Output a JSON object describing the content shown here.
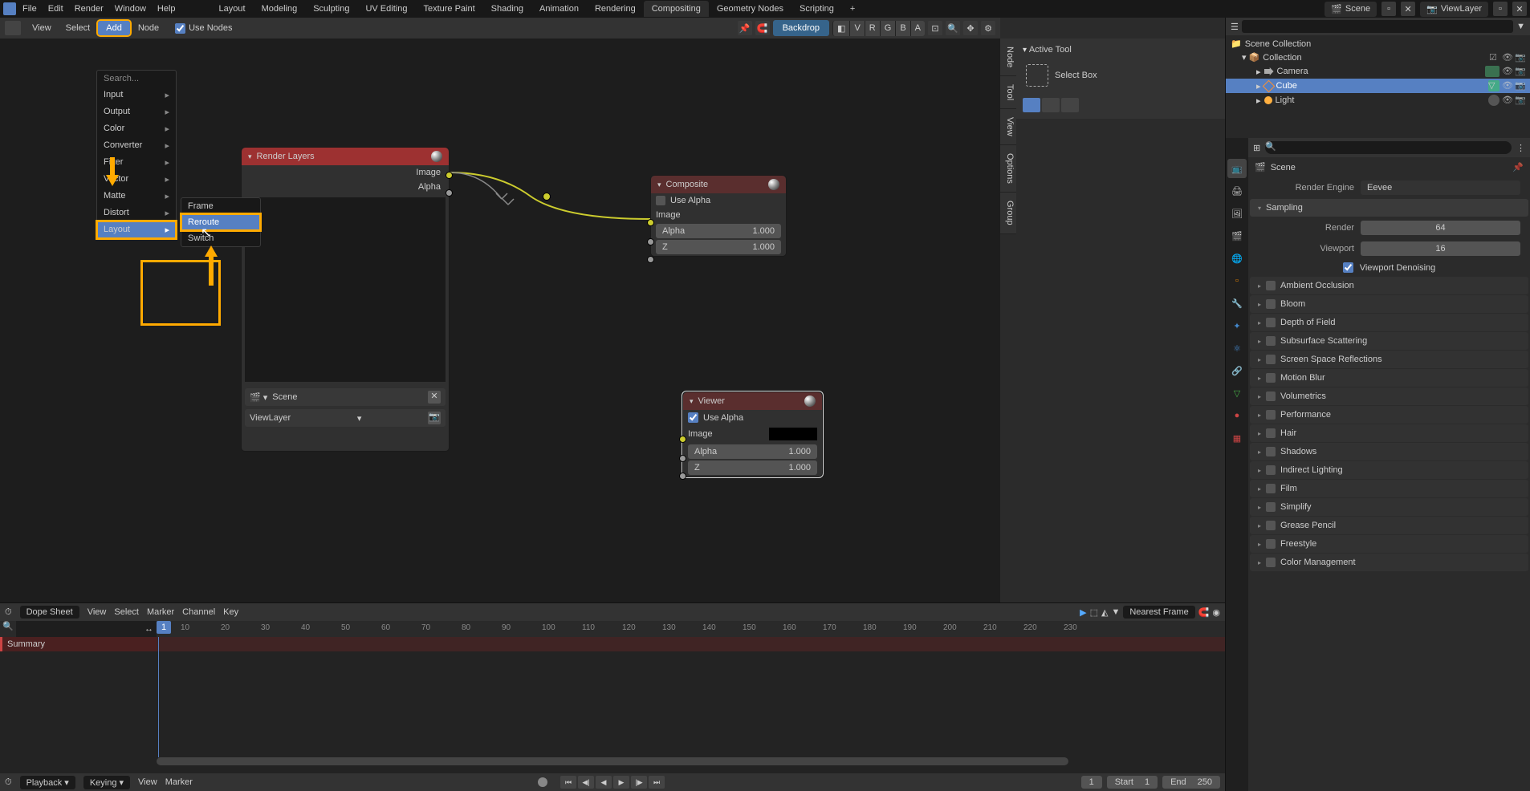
{
  "topbar": {
    "menus": [
      "File",
      "Edit",
      "Render",
      "Window",
      "Help"
    ],
    "tabs": [
      "Layout",
      "Modeling",
      "Sculpting",
      "UV Editing",
      "Texture Paint",
      "Shading",
      "Animation",
      "Rendering",
      "Compositing",
      "Geometry Nodes",
      "Scripting"
    ],
    "active_tab": "Compositing",
    "scene": "Scene",
    "viewlayer": "ViewLayer"
  },
  "compositor_header": {
    "menus": [
      "View",
      "Select"
    ],
    "add": "Add",
    "node": "Node",
    "use_nodes": "Use Nodes",
    "backdrop": "Backdrop",
    "channels": [
      "V",
      "R",
      "G",
      "B",
      "A"
    ]
  },
  "breadcrumb": {
    "scene": "Scene"
  },
  "add_menu": {
    "search": "Search...",
    "items": [
      "Input",
      "Output",
      "Color",
      "Converter",
      "Filter",
      "Vector",
      "Matte",
      "Distort"
    ],
    "highlighted": "Layout"
  },
  "layout_submenu": {
    "items": [
      "Frame",
      "Reroute",
      "Switch"
    ],
    "highlighted": "Reroute"
  },
  "side_tabs": [
    "Node",
    "Tool",
    "View",
    "Options",
    "Group"
  ],
  "n_panel": {
    "title": "Active Tool",
    "tool": "Select Box"
  },
  "nodes": {
    "render_layers": {
      "title": "Render Layers",
      "outputs": [
        "Image",
        "Alpha"
      ],
      "scene": "Scene",
      "viewlayer": "ViewLayer"
    },
    "composite": {
      "title": "Composite",
      "use_alpha": "Use Alpha",
      "image": "Image",
      "alpha_lbl": "Alpha",
      "alpha_val": "1.000",
      "z_lbl": "Z",
      "z_val": "1.000"
    },
    "viewer": {
      "title": "Viewer",
      "use_alpha": "Use Alpha",
      "image": "Image",
      "alpha_lbl": "Alpha",
      "alpha_val": "1.000",
      "z_lbl": "Z",
      "z_val": "1.000"
    }
  },
  "outliner": {
    "root": "Scene Collection",
    "collection": "Collection",
    "items": [
      "Camera",
      "Cube",
      "Light"
    ],
    "selected": "Cube"
  },
  "properties": {
    "scene": "Scene",
    "render_engine_lbl": "Render Engine",
    "render_engine": "Eevee",
    "sampling": "Sampling",
    "render_lbl": "Render",
    "render_val": "64",
    "viewport_lbl": "Viewport",
    "viewport_val": "16",
    "viewport_denoise": "Viewport Denoising",
    "sections": [
      "Ambient Occlusion",
      "Bloom",
      "Depth of Field",
      "Subsurface Scattering",
      "Screen Space Reflections",
      "Motion Blur",
      "Volumetrics",
      "Performance",
      "Hair",
      "Shadows",
      "Indirect Lighting",
      "Film",
      "Simplify",
      "Grease Pencil",
      "Freestyle",
      "Color Management"
    ]
  },
  "dopesheet": {
    "mode": "Dope Sheet",
    "menus": [
      "View",
      "Select",
      "Marker",
      "Channel",
      "Key"
    ],
    "nearest": "Nearest Frame",
    "summary": "Summary",
    "current_frame": "1",
    "ticks": [
      "10",
      "20",
      "30",
      "40",
      "50",
      "60",
      "70",
      "80",
      "90",
      "100",
      "110",
      "120",
      "130",
      "140",
      "150",
      "160",
      "170",
      "180",
      "190",
      "200",
      "210",
      "220",
      "230"
    ]
  },
  "timeline_footer": {
    "playback": "Playback",
    "keying": "Keying",
    "view": "View",
    "marker": "Marker",
    "frame": "1",
    "start_lbl": "Start",
    "start": "1",
    "end_lbl": "End",
    "end": "250"
  }
}
